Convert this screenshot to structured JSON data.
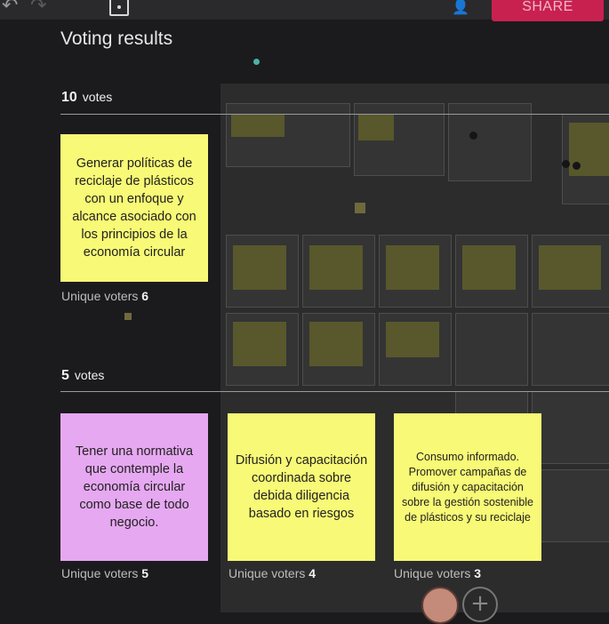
{
  "toolbar": {
    "share_label": "SHARE",
    "undo_icon": "↶",
    "redo_icon": "↷",
    "user_icon": "👤"
  },
  "panel": {
    "title": "Voting results"
  },
  "groups": [
    {
      "count": "10",
      "suffix": "votes",
      "notes": [
        {
          "text": "Generar políticas de reciclaje de plásticos con un enfoque y alcance asociado con los principios de la economía circular",
          "color": "#f8f976",
          "voters_label": "Unique voters",
          "voters_count": "6"
        }
      ]
    },
    {
      "count": "5",
      "suffix": "votes",
      "notes": [
        {
          "text": "Tener una normativa que contemple la economía circular como base de todo negocio.",
          "color": "#e6a8f1",
          "voters_label": "Unique voters",
          "voters_count": "5"
        },
        {
          "text": "Difusión y capacitación coordinada sobre debida diligencia basado en riesgos",
          "color": "#f8f976",
          "voters_label": "Unique voters",
          "voters_count": "4"
        },
        {
          "text": "Consumo informado. Promover campañas de difusión y capacitación sobre la gestión sostenible de plásticos y su reciclaje",
          "color": "#f8f976",
          "voters_label": "Unique voters",
          "voters_count": "3"
        }
      ]
    }
  ],
  "bottom": {
    "add_icon": "+"
  },
  "colors": {
    "share": "#c8214f",
    "background": "#1b1b1d",
    "yellow_note": "#f8f976",
    "purple_note": "#e6a8f1"
  }
}
